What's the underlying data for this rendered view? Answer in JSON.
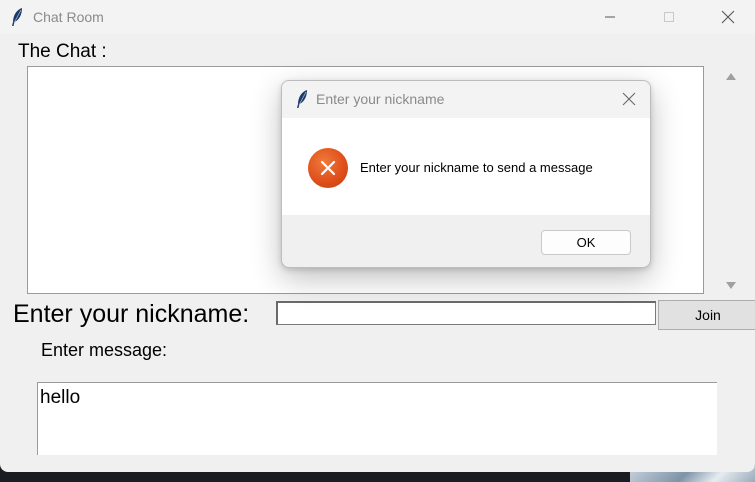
{
  "window": {
    "title": "Chat Room",
    "icon": "feather-icon",
    "controls": [
      "minimize-icon",
      "maximize-icon",
      "close-icon"
    ]
  },
  "chat": {
    "label": "The Chat :",
    "content": ""
  },
  "nickname": {
    "label": "Enter your nickname:",
    "value": "",
    "join_label": "Join"
  },
  "message": {
    "label": "Enter message:",
    "value": "hello"
  },
  "dialog": {
    "title": "Enter your nickname",
    "icon": "error-icon",
    "message": "Enter your nickname to send a message",
    "ok_label": "OK"
  }
}
